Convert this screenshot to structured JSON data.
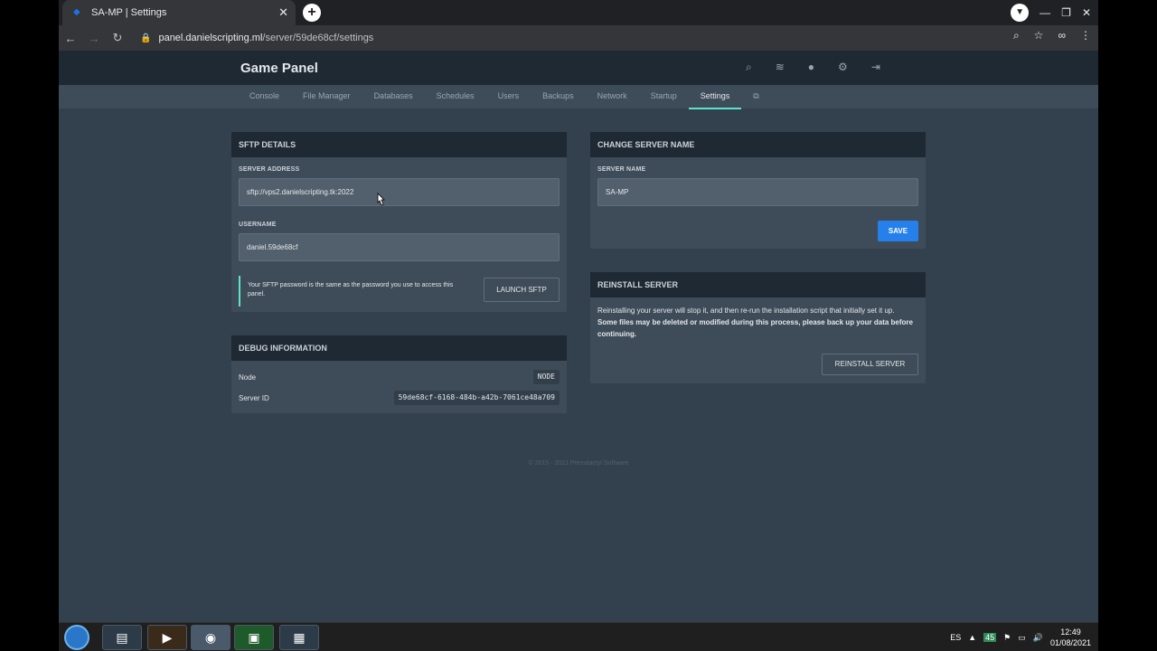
{
  "browser": {
    "tab_title": "SA-MP | Settings",
    "tab_close": "✕",
    "new_tab": "+",
    "url_host": "panel.danielscripting.ml",
    "url_path": "/server/59de68cf/settings"
  },
  "header": {
    "brand": "Game Panel"
  },
  "subnav": {
    "items": [
      "Console",
      "File Manager",
      "Databases",
      "Schedules",
      "Users",
      "Backups",
      "Network",
      "Startup",
      "Settings"
    ],
    "active": "Settings"
  },
  "sftp": {
    "title": "SFTP DETAILS",
    "address_label": "SERVER ADDRESS",
    "address_value": "sftp://vps2.danielscripting.tk:2022",
    "username_label": "USERNAME",
    "username_value": "daniel.59de68cf",
    "note": "Your SFTP password is the same as the password you use to access this panel.",
    "launch_button": "LAUNCH SFTP"
  },
  "debug": {
    "title": "DEBUG INFORMATION",
    "node_label": "Node",
    "node_value": "NODE",
    "server_id_label": "Server ID",
    "server_id_value": "59de68cf-6168-484b-a42b-7061ce48a709"
  },
  "rename": {
    "title": "CHANGE SERVER NAME",
    "name_label": "SERVER NAME",
    "name_value": "SA-MP",
    "save_button": "SAVE"
  },
  "reinstall": {
    "title": "REINSTALL SERVER",
    "text_normal": "Reinstalling your server will stop it, and then re-run the installation script that initially set it up.",
    "text_bold": "Some files may be deleted or modified during this process, please back up your data before continuing.",
    "button": "REINSTALL SERVER"
  },
  "footer": "© 2015 - 2021 Pterodactyl Software",
  "taskbar": {
    "lang": "ES",
    "time": "12:49",
    "date": "01/08/2021"
  }
}
